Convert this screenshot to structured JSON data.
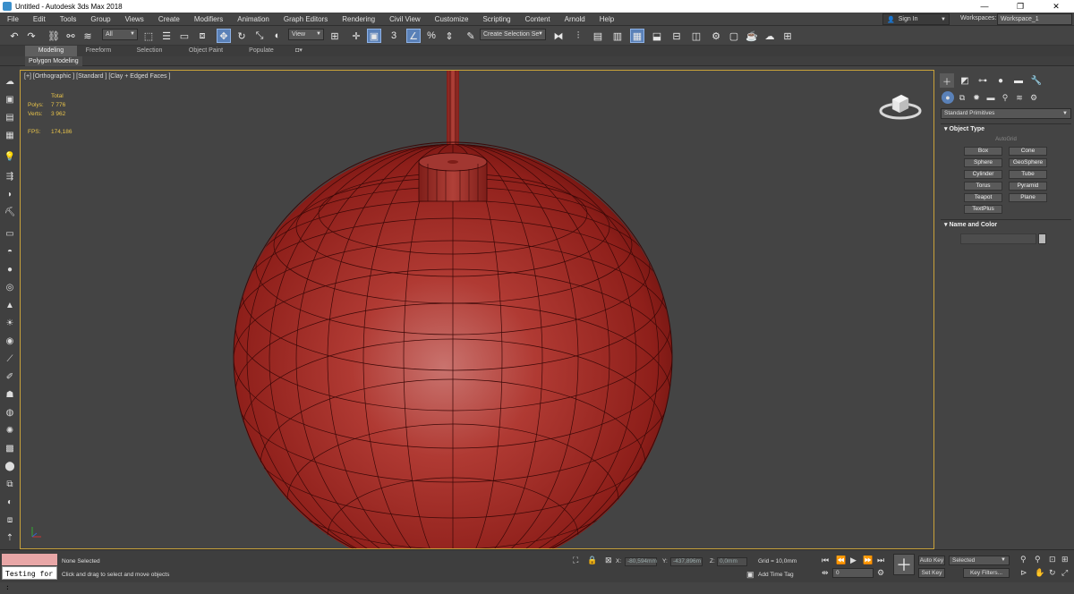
{
  "window": {
    "title": "Untitled - Autodesk 3ds Max 2018",
    "minimize": "—",
    "restore": "❐",
    "close": "✕"
  },
  "menu": [
    "File",
    "Edit",
    "Tools",
    "Group",
    "Views",
    "Create",
    "Modifiers",
    "Animation",
    "Graph Editors",
    "Rendering",
    "Civil View",
    "Customize",
    "Scripting",
    "Content",
    "Arnold",
    "Help"
  ],
  "account": {
    "sign_in": "Sign In",
    "workspaces_label": "Workspaces:",
    "workspace_value": "Workspace_1"
  },
  "toolbar": {
    "filter_value": "All",
    "refcoord_value": "View",
    "selection_set_placeholder": "Create Selection Se",
    "snap_label": "3"
  },
  "ribbon": {
    "tabs": [
      "Modeling",
      "Freeform",
      "Selection",
      "Object Paint",
      "Populate"
    ],
    "active_tab": "Modeling",
    "panel_label": "Polygon Modeling"
  },
  "viewport": {
    "label": "[+] [Orthographic ] [Standard ] [Clay + Edged Faces ]",
    "stats": {
      "header": "Total",
      "polys_label": "Polys:",
      "polys_value": "7 776",
      "verts_label": "Verts:",
      "verts_value": "3 962",
      "fps_label": "FPS:",
      "fps_value": "174,186"
    },
    "model_color": "#a8312a",
    "border_color": "#c9a23a"
  },
  "command_panel": {
    "category": "Standard Primitives",
    "object_type_title": "Object Type",
    "autogrid": "AutoGrid",
    "buttons": [
      "Box",
      "Cone",
      "Sphere",
      "GeoSphere",
      "Cylinder",
      "Tube",
      "Torus",
      "Pyramid",
      "Teapot",
      "Plane",
      "TextPlus"
    ],
    "name_color_title": "Name and Color"
  },
  "status": {
    "maxscript_text": "Testing for :",
    "selection_status": "None Selected",
    "prompt": "Click and drag to select and move objects",
    "x_label": "X:",
    "x_value": "-80,594mm",
    "y_label": "Y:",
    "y_value": "-437,896m",
    "z_label": "Z:",
    "z_value": "0,0mm",
    "grid": "Grid = 10,0mm",
    "add_time_tag": "Add Time Tag",
    "frame_value": "0",
    "auto_key": "Auto Key",
    "set_key": "Set Key",
    "selected_value": "Selected",
    "key_filters": "Key Filters..."
  }
}
